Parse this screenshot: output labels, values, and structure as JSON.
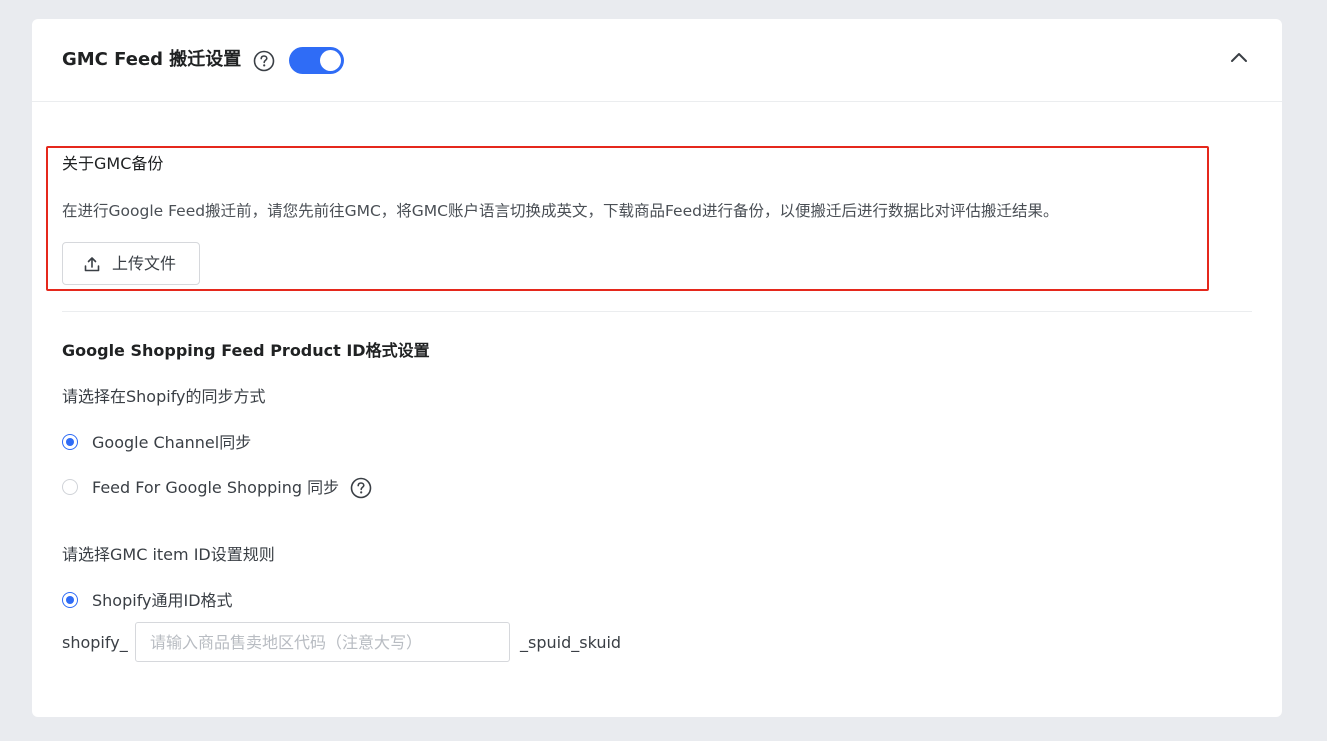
{
  "header": {
    "title": "GMC Feed 搬迁设置",
    "help_icon": "question-circle-icon",
    "toggle_on": true,
    "collapse_icon": "chevron-up-icon"
  },
  "backup": {
    "title": "关于GMC备份",
    "description": "在进行Google Feed搬迁前，请您先前往GMC，将GMC账户语言切换成英文，下载商品Feed进行备份，以便搬迁后进行数据比对评估搬迁结果。",
    "upload_label": "上传文件",
    "upload_icon": "upload-icon"
  },
  "product_id": {
    "title": "Google Shopping Feed Product ID格式设置",
    "sync_label": "请选择在Shopify的同步方式",
    "sync_options": [
      {
        "label": "Google Channel同步",
        "checked": true
      },
      {
        "label": "Feed For Google Shopping 同步",
        "checked": false
      }
    ],
    "rule_label": "请选择GMC item ID设置规则",
    "rule_options": [
      {
        "label": "Shopify通用ID格式",
        "checked": true
      }
    ],
    "id_prefix": "shopify_",
    "region_placeholder": "请输入商品售卖地区代码（注意大写）",
    "region_value": "",
    "id_suffix": "_spuid_skuid"
  },
  "colors": {
    "accent": "#2f6cf6",
    "highlight_border": "#e5281c",
    "background": "#e9ebef"
  }
}
